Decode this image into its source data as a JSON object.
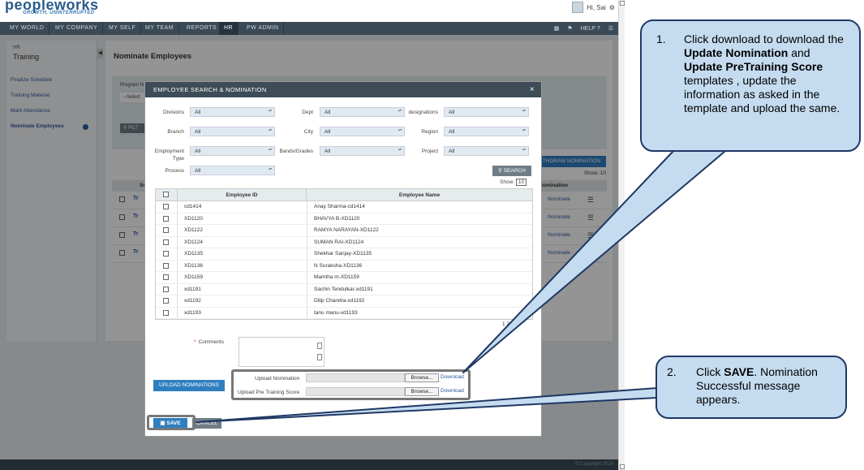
{
  "header": {
    "logo": "peopleworks",
    "tagline": "GROWTH, UNINTERRUPTED",
    "user_greeting": "Hi, Sai"
  },
  "nav": {
    "items": [
      "MY WORLD",
      "MY COMPANY",
      "MY SELF",
      "MY TEAM",
      "REPORTS",
      "HR",
      "PW ADMIN"
    ],
    "active": "HR",
    "help": "HELP"
  },
  "sidebar": {
    "section": "HR",
    "title": "Training",
    "items": [
      "Finalize Schedule",
      "Training Material",
      "Mark Attendance",
      "Nominate Employees"
    ]
  },
  "main": {
    "title": "Nominate Employees",
    "program_label": "Program N",
    "select_placeholder": "--Select",
    "filter_label": "FILT",
    "withdraw_label": "THDRAW NOMINATION",
    "show_label": "Show:",
    "show_value": "10",
    "col_sc": "Sc",
    "col_nomination": "Nomination",
    "rows": [
      {
        "tr": "Tr",
        "action": "Nominate"
      },
      {
        "tr": "Tr",
        "action": "Nominate"
      },
      {
        "tr": "Tr",
        "action": "Nominate"
      },
      {
        "tr": "Tr",
        "action": "Nominate"
      }
    ]
  },
  "modal": {
    "title": "EMPLOYEE SEARCH & NOMINATION",
    "close": "×",
    "filters": {
      "divisions": {
        "label": "Divisions",
        "value": "All"
      },
      "dept": {
        "label": "Dept",
        "value": "All"
      },
      "designations": {
        "label": "designations",
        "value": "All"
      },
      "branch": {
        "label": "Branch",
        "value": "All"
      },
      "city": {
        "label": "City",
        "value": "All"
      },
      "region": {
        "label": "Region",
        "value": "All"
      },
      "employment_type": {
        "label1": "Employment",
        "label2": "Type",
        "value": "All"
      },
      "bands": {
        "label": "Bands/Grades",
        "value": "All"
      },
      "project": {
        "label": "Project",
        "value": "All"
      },
      "process": {
        "label": "Process",
        "value": "All"
      }
    },
    "search_label": "SEARCH",
    "show_label": "Show:",
    "show_value": "10",
    "table": {
      "col_id": "Employee ID",
      "col_name": "Employee Name",
      "rows": [
        {
          "id": "cd1414",
          "name": "Anay Sharma-cd1414"
        },
        {
          "id": "XD1120",
          "name": "BHAVYA B-XD1120"
        },
        {
          "id": "XD1122",
          "name": "RAMYA NARAYAN-XD1122"
        },
        {
          "id": "XD1124",
          "name": "SUMAN RAI-XD1124"
        },
        {
          "id": "XD1135",
          "name": "Shekhar Sanjay-XD1135"
        },
        {
          "id": "XD1136",
          "name": "N Suraksha-XD1136"
        },
        {
          "id": "XD1159",
          "name": "Mamtha m-XD1159"
        },
        {
          "id": "xd1191",
          "name": "Sachin Tendulkar-xd1191"
        },
        {
          "id": "xd1192",
          "name": "Dilip Chandra-xd1192"
        },
        {
          "id": "xd1193",
          "name": "tanu manu-xd1193"
        }
      ]
    },
    "pager": "1 2",
    "comments_label": "Comments",
    "upload_nominations_label": "UPLOAD NOMINATIONS",
    "upload_nomination_label": "Upload Nomination",
    "upload_pre_training_label": "Upload Pre Training Score",
    "browse_label": "Browse...",
    "download_label": "Download",
    "save_label": "SAVE",
    "cancel_label": "CANCEL"
  },
  "footer": {
    "copyright": "© Copyright 2016"
  },
  "callouts": {
    "one": {
      "num": "1.",
      "t1": "Click download to download the ",
      "b1": "Update Nomination",
      "t2": " and ",
      "b2": "Update PreTraining Score",
      "t3": " templates , update the information as asked in the template and upload the same."
    },
    "two": {
      "num": "2.",
      "t1": "Click ",
      "b1": "SAVE",
      "t2": ". Nomination Successful message appears."
    }
  },
  "colors": {
    "nav_bg": "#3a4a56",
    "accent": "#2f7fbf",
    "callout_fill": "#c5dcf0",
    "callout_border": "#1f3864"
  }
}
